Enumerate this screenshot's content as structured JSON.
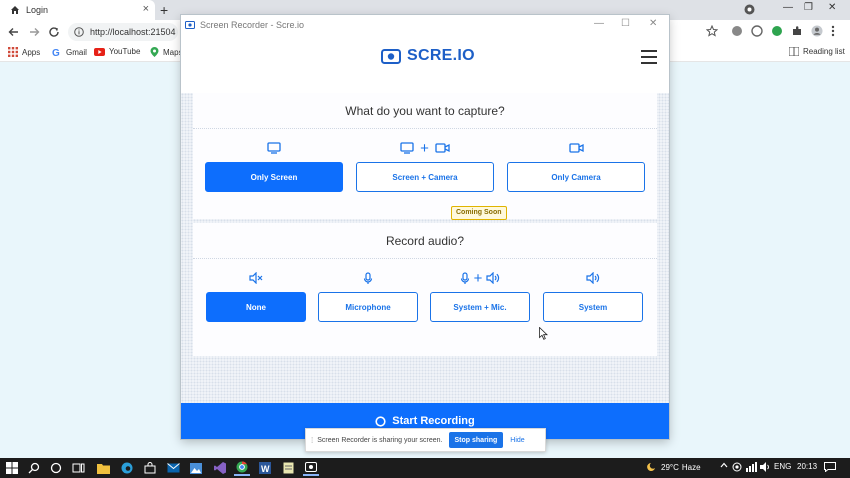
{
  "browser": {
    "tab_title": "Login",
    "tab_close": "×",
    "new_tab": "+",
    "url": "http://localhost:21504",
    "win_min": "—",
    "win_restore": "❐",
    "win_close": "✕",
    "bookmarks": [
      {
        "label": "Apps"
      },
      {
        "label": "Gmail"
      },
      {
        "label": "YouTube"
      },
      {
        "label": "Maps"
      }
    ],
    "reading_list": "Reading list"
  },
  "app": {
    "window_title": "Screen Recorder - Scre.io",
    "ctl_min": "—",
    "ctl_max": "☐",
    "ctl_close": "✕",
    "logo_text": "SCRE.IO",
    "capture": {
      "heading": "What do you want to capture?",
      "plus": "+",
      "options": [
        {
          "label": "Only Screen",
          "active": true
        },
        {
          "label": "Screen + Camera",
          "active": false
        },
        {
          "label": "Only Camera",
          "active": false
        }
      ],
      "badge": "Coming Soon"
    },
    "audio": {
      "heading": "Record audio?",
      "plus": "+",
      "options": [
        {
          "label": "None",
          "active": true
        },
        {
          "label": "Microphone",
          "active": false
        },
        {
          "label": "System + Mic.",
          "active": false
        },
        {
          "label": "System",
          "active": false
        }
      ]
    },
    "start_label": "Start Recording"
  },
  "sharing": {
    "grip": "⁞",
    "message": "Screen Recorder is sharing your screen.",
    "stop_label": "Stop sharing",
    "hide_label": "Hide"
  },
  "taskbar": {
    "temperature": "29°C",
    "weather": "Haze",
    "lang": "ENG",
    "time": "20:13"
  },
  "colors": {
    "primary": "#0d6efd",
    "logo": "#1d5fc7"
  }
}
